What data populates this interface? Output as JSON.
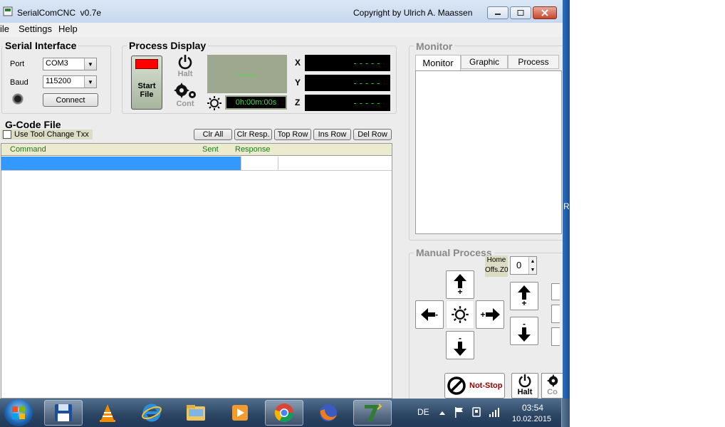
{
  "window": {
    "title": "SerialComCNC  v0.7e",
    "copyright": "Copyright by Ulrich A. Maassen"
  },
  "menu": {
    "file": "ile",
    "settings": "Settings",
    "help": "Help"
  },
  "serial": {
    "title": "Serial Interface",
    "port_label": "Port",
    "port_value": "COM3",
    "baud_label": "Baud",
    "baud_value": "115200",
    "connect": "Connect"
  },
  "process": {
    "title": "Process Display",
    "start_line1": "Start",
    "start_line2": "File",
    "halt": "Halt",
    "cont": "Cont",
    "status_dashes": "-----",
    "timer": "0h:00m:00s",
    "axes": [
      {
        "label": "X",
        "value": "-----"
      },
      {
        "label": "Y",
        "value": "-----"
      },
      {
        "label": "Z",
        "value": "-----"
      }
    ]
  },
  "gcode": {
    "title": "G-Code File",
    "tool_change": "Use Tool Change Txx",
    "buttons": [
      "Clr All",
      "Clr Resp.",
      "Top Row",
      "Ins Row",
      "Del Row"
    ],
    "columns": [
      "Command",
      "Sent",
      "Response"
    ]
  },
  "monitor": {
    "title": "Monitor",
    "tabs": [
      "Monitor",
      "Graphic",
      "Process"
    ]
  },
  "manual": {
    "title": "Manual Process",
    "home_line1": "Home",
    "home_line2": "Offs.Z0",
    "home_value": "0",
    "plus": "+",
    "minus": "-",
    "not_stop": "Not-Stop",
    "halt": "Halt",
    "partial": "Co"
  },
  "side_char": "R",
  "taskbar": {
    "lang": "DE",
    "time": "03:54",
    "date": "10.02.2015"
  },
  "colors": {
    "selection": "#3399ff",
    "green_text": "#1fd41f",
    "column_header": "#1a7a1a",
    "stop_red": "#a00000"
  }
}
